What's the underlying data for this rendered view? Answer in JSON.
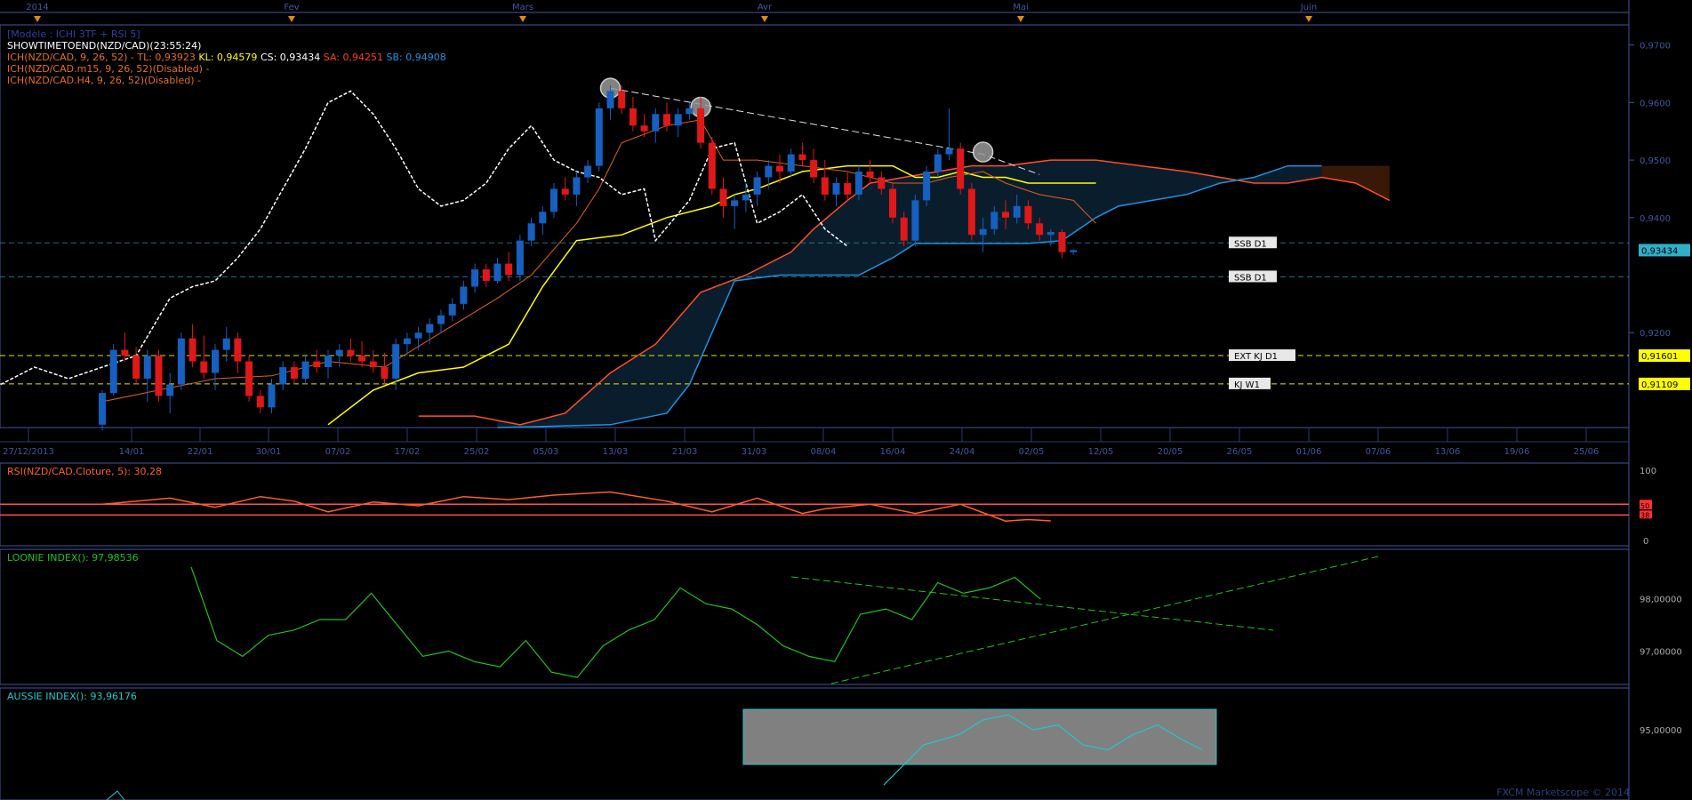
{
  "header": {
    "model": "[Modèle : ICHI 3TF + RSI 5]",
    "show_time": "SHOWTIMETOEND(NZD/CAD)(23:55:24)",
    "ich_main_prefix": "ICH(NZD/CAD, 9, 26, 52) -",
    "tl": "TL: 0,93923",
    "kl": "KL: 0,94579",
    "cs": "CS: 0,93434",
    "sa": "SA: 0,94251",
    "sb": "SB: 0,94908",
    "ich_m15": "ICH(NZD/CAD.m15, 9, 26, 52)(Disabled) -",
    "ich_h4": "ICH(NZD/CAD.H4, 9, 26, 52)(Disabled) -"
  },
  "colors": {
    "blue_candle": "#1560c0",
    "red_candle": "#e01818",
    "tenkan": "#e06020",
    "kijun": "#ffff00",
    "chikou": "#ffffff",
    "ssa": "#ff5020",
    "ssb": "#2090e0",
    "cloud": "#0a1d2c",
    "cloud_bear": "#3a1808",
    "rsi": "#ff6020",
    "loonie": "#20c020",
    "aussie": "#20c8d0",
    "axis": "#4455a0"
  },
  "month_labels": [
    "2014",
    "Fev",
    "Mars",
    "Avr",
    "Mai",
    "Juin"
  ],
  "date_labels": [
    "27/12/2013",
    "14/01",
    "22/01",
    "30/01",
    "07/02",
    "17/02",
    "25/02",
    "05/03",
    "13/03",
    "21/03",
    "31/03",
    "08/04",
    "16/04",
    "24/04",
    "02/05",
    "12/05",
    "20/05",
    "26/05",
    "01/06",
    "07/06",
    "13/06",
    "19/06",
    "25/06"
  ],
  "price_axis": {
    "ticks": [
      "0,9700",
      "0,9600",
      "0,9500",
      "0,9400",
      "0,9200"
    ],
    "current_price": "0,93434"
  },
  "level_lines": [
    {
      "label": "SSB D1",
      "value": 0.9356
    },
    {
      "label": "SSB D1",
      "value": 0.9297
    },
    {
      "label": "EXT KJ D1",
      "value": 0.91601,
      "value_label": "0,91601"
    },
    {
      "label": "KJ W1",
      "value": 0.91109,
      "value_label": "0,91109"
    }
  ],
  "trendline_text": "",
  "rsi_panel": {
    "title": "RSI(NZD/CAD.Cloture, 5): 30,28",
    "axis": [
      "100",
      "0"
    ],
    "levels": [
      "52",
      "50",
      "38"
    ]
  },
  "loonie_panel": {
    "title": "LOONIE INDEX(): 97,98536",
    "axis": [
      "98,00000",
      "97,00000"
    ]
  },
  "aussie_panel": {
    "title": "AUSSIE INDEX(): 93,96176",
    "axis": [
      "95,00000"
    ]
  },
  "watermark": "FXCM Marketscope © 2014",
  "chart_data": {
    "type": "candlestick",
    "title": "",
    "y_range": [
      0.9035,
      0.9735
    ],
    "candles": [
      [
        0.904,
        0.91,
        0.903,
        0.9095
      ],
      [
        0.9095,
        0.918,
        0.909,
        0.917
      ],
      [
        0.917,
        0.92,
        0.915,
        0.916
      ],
      [
        0.916,
        0.9175,
        0.911,
        0.912
      ],
      [
        0.912,
        0.917,
        0.908,
        0.916
      ],
      [
        0.916,
        0.917,
        0.908,
        0.909
      ],
      [
        0.909,
        0.913,
        0.906,
        0.911
      ],
      [
        0.911,
        0.92,
        0.91,
        0.919
      ],
      [
        0.919,
        0.9215,
        0.914,
        0.915
      ],
      [
        0.915,
        0.9195,
        0.912,
        0.913
      ],
      [
        0.913,
        0.918,
        0.91,
        0.917
      ],
      [
        0.917,
        0.921,
        0.915,
        0.919
      ],
      [
        0.919,
        0.92,
        0.913,
        0.915
      ],
      [
        0.915,
        0.916,
        0.908,
        0.909
      ],
      [
        0.909,
        0.91,
        0.906,
        0.907
      ],
      [
        0.907,
        0.912,
        0.906,
        0.911
      ],
      [
        0.911,
        0.915,
        0.91,
        0.914
      ],
      [
        0.914,
        0.915,
        0.911,
        0.912
      ],
      [
        0.912,
        0.916,
        0.911,
        0.915
      ],
      [
        0.915,
        0.917,
        0.913,
        0.914
      ],
      [
        0.914,
        0.917,
        0.912,
        0.916
      ],
      [
        0.916,
        0.918,
        0.914,
        0.917
      ],
      [
        0.917,
        0.919,
        0.915,
        0.916
      ],
      [
        0.916,
        0.9185,
        0.914,
        0.915
      ],
      [
        0.915,
        0.917,
        0.913,
        0.914
      ],
      [
        0.914,
        0.9165,
        0.911,
        0.912
      ],
      [
        0.912,
        0.919,
        0.91,
        0.918
      ],
      [
        0.918,
        0.92,
        0.916,
        0.919
      ],
      [
        0.919,
        0.921,
        0.917,
        0.92
      ],
      [
        0.92,
        0.9225,
        0.918,
        0.9215
      ],
      [
        0.9215,
        0.924,
        0.92,
        0.923
      ],
      [
        0.923,
        0.926,
        0.922,
        0.925
      ],
      [
        0.925,
        0.929,
        0.924,
        0.928
      ],
      [
        0.928,
        0.932,
        0.927,
        0.931
      ],
      [
        0.931,
        0.932,
        0.928,
        0.929
      ],
      [
        0.929,
        0.933,
        0.9285,
        0.932
      ],
      [
        0.932,
        0.934,
        0.929,
        0.93
      ],
      [
        0.93,
        0.937,
        0.929,
        0.936
      ],
      [
        0.936,
        0.94,
        0.935,
        0.939
      ],
      [
        0.939,
        0.942,
        0.937,
        0.941
      ],
      [
        0.941,
        0.946,
        0.94,
        0.945
      ],
      [
        0.945,
        0.947,
        0.943,
        0.944
      ],
      [
        0.944,
        0.948,
        0.942,
        0.947
      ],
      [
        0.947,
        0.95,
        0.946,
        0.949
      ],
      [
        0.949,
        0.96,
        0.948,
        0.959
      ],
      [
        0.959,
        0.963,
        0.957,
        0.962
      ],
      [
        0.962,
        0.963,
        0.958,
        0.959
      ],
      [
        0.959,
        0.961,
        0.955,
        0.956
      ],
      [
        0.956,
        0.958,
        0.954,
        0.955
      ],
      [
        0.955,
        0.959,
        0.953,
        0.958
      ],
      [
        0.958,
        0.96,
        0.955,
        0.956
      ],
      [
        0.956,
        0.959,
        0.954,
        0.958
      ],
      [
        0.958,
        0.96,
        0.957,
        0.959
      ],
      [
        0.959,
        0.961,
        0.952,
        0.953
      ],
      [
        0.953,
        0.954,
        0.944,
        0.945
      ],
      [
        0.945,
        0.947,
        0.94,
        0.942
      ],
      [
        0.942,
        0.944,
        0.938,
        0.943
      ],
      [
        0.943,
        0.946,
        0.941,
        0.944
      ],
      [
        0.944,
        0.948,
        0.942,
        0.947
      ],
      [
        0.947,
        0.95,
        0.945,
        0.949
      ],
      [
        0.949,
        0.951,
        0.946,
        0.948
      ],
      [
        0.948,
        0.952,
        0.947,
        0.951
      ],
      [
        0.951,
        0.953,
        0.949,
        0.95
      ],
      [
        0.95,
        0.952,
        0.946,
        0.947
      ],
      [
        0.947,
        0.95,
        0.943,
        0.944
      ],
      [
        0.944,
        0.947,
        0.942,
        0.946
      ],
      [
        0.946,
        0.948,
        0.943,
        0.944
      ],
      [
        0.944,
        0.949,
        0.943,
        0.948
      ],
      [
        0.948,
        0.95,
        0.946,
        0.947
      ],
      [
        0.947,
        0.948,
        0.944,
        0.945
      ],
      [
        0.945,
        0.946,
        0.939,
        0.94
      ],
      [
        0.94,
        0.941,
        0.935,
        0.936
      ],
      [
        0.936,
        0.944,
        0.935,
        0.943
      ],
      [
        0.943,
        0.949,
        0.942,
        0.948
      ],
      [
        0.948,
        0.952,
        0.947,
        0.951
      ],
      [
        0.951,
        0.959,
        0.95,
        0.952
      ],
      [
        0.952,
        0.953,
        0.944,
        0.945
      ],
      [
        0.945,
        0.946,
        0.936,
        0.937
      ],
      [
        0.937,
        0.94,
        0.934,
        0.938
      ],
      [
        0.938,
        0.942,
        0.937,
        0.941
      ],
      [
        0.941,
        0.943,
        0.938,
        0.94
      ],
      [
        0.94,
        0.944,
        0.939,
        0.942
      ],
      [
        0.942,
        0.943,
        0.938,
        0.939
      ],
      [
        0.939,
        0.94,
        0.936,
        0.937
      ],
      [
        0.937,
        0.938,
        0.935,
        0.9375
      ],
      [
        0.9375,
        0.938,
        0.933,
        0.934
      ],
      [
        0.934,
        0.9345,
        0.9335,
        0.93434
      ]
    ],
    "tenkan": [
      [
        0,
        0.908
      ],
      [
        5,
        0.91
      ],
      [
        10,
        0.912
      ],
      [
        15,
        0.9125
      ],
      [
        20,
        0.915
      ],
      [
        25,
        0.914
      ],
      [
        30,
        0.92
      ],
      [
        35,
        0.926
      ],
      [
        38,
        0.93
      ],
      [
        42,
        0.939
      ],
      [
        44,
        0.945
      ],
      [
        46,
        0.953
      ],
      [
        50,
        0.956
      ],
      [
        53,
        0.957
      ],
      [
        55,
        0.95
      ],
      [
        58,
        0.95
      ],
      [
        62,
        0.949
      ],
      [
        66,
        0.948
      ],
      [
        70,
        0.946
      ],
      [
        73,
        0.946
      ],
      [
        75,
        0.947
      ],
      [
        78,
        0.948
      ],
      [
        80,
        0.946
      ],
      [
        83,
        0.944
      ],
      [
        86,
        0.943
      ],
      [
        88,
        0.939
      ]
    ],
    "kijun": [
      [
        20,
        0.904
      ],
      [
        24,
        0.91
      ],
      [
        28,
        0.913
      ],
      [
        32,
        0.914
      ],
      [
        36,
        0.918
      ],
      [
        39,
        0.928
      ],
      [
        42,
        0.936
      ],
      [
        46,
        0.937
      ],
      [
        50,
        0.94
      ],
      [
        54,
        0.942
      ],
      [
        56,
        0.944
      ],
      [
        58,
        0.945
      ],
      [
        62,
        0.948
      ],
      [
        66,
        0.949
      ],
      [
        70,
        0.949
      ],
      [
        72,
        0.947
      ],
      [
        74,
        0.947
      ],
      [
        76,
        0.948
      ],
      [
        78,
        0.947
      ],
      [
        80,
        0.947
      ],
      [
        82,
        0.946
      ],
      [
        88,
        0.946
      ]
    ],
    "chikou": [
      [
        -9,
        0.911
      ],
      [
        -6,
        0.914
      ],
      [
        -3,
        0.912
      ],
      [
        0,
        0.914
      ],
      [
        3,
        0.916
      ],
      [
        6,
        0.926
      ],
      [
        8,
        0.928
      ],
      [
        10,
        0.929
      ],
      [
        12,
        0.933
      ],
      [
        14,
        0.938
      ],
      [
        16,
        0.945
      ],
      [
        18,
        0.952
      ],
      [
        20,
        0.96
      ],
      [
        22,
        0.962
      ],
      [
        24,
        0.958
      ],
      [
        26,
        0.952
      ],
      [
        28,
        0.945
      ],
      [
        30,
        0.942
      ],
      [
        32,
        0.943
      ],
      [
        34,
        0.946
      ],
      [
        36,
        0.952
      ],
      [
        38,
        0.956
      ],
      [
        40,
        0.95
      ],
      [
        42,
        0.948
      ],
      [
        44,
        0.947
      ],
      [
        46,
        0.944
      ],
      [
        48,
        0.945
      ],
      [
        49,
        0.936
      ],
      [
        52,
        0.943
      ],
      [
        54,
        0.952
      ],
      [
        56,
        0.953
      ],
      [
        58,
        0.939
      ],
      [
        60,
        0.941
      ],
      [
        62,
        0.944
      ],
      [
        64,
        0.938
      ],
      [
        66,
        0.935
      ]
    ],
    "ssa": [
      [
        28,
        0.9055
      ],
      [
        33,
        0.9055
      ],
      [
        37,
        0.904
      ],
      [
        41,
        0.906
      ],
      [
        45,
        0.913
      ],
      [
        49,
        0.918
      ],
      [
        53,
        0.927
      ],
      [
        57,
        0.93
      ],
      [
        61,
        0.934
      ],
      [
        63,
        0.938
      ],
      [
        66,
        0.943
      ],
      [
        68,
        0.946
      ],
      [
        71,
        0.947
      ],
      [
        74,
        0.948
      ],
      [
        77,
        0.949
      ],
      [
        80,
        0.949
      ],
      [
        84,
        0.95
      ],
      [
        88,
        0.95
      ],
      [
        92,
        0.949
      ],
      [
        96,
        0.948
      ],
      [
        99,
        0.947
      ],
      [
        102,
        0.946
      ],
      [
        105,
        0.946
      ],
      [
        108,
        0.947
      ],
      [
        111,
        0.946
      ],
      [
        114,
        0.943
      ]
    ],
    "ssb": [
      [
        35,
        0.9035
      ],
      [
        45,
        0.904
      ],
      [
        50,
        0.906
      ],
      [
        52,
        0.911
      ],
      [
        54,
        0.92
      ],
      [
        56,
        0.929
      ],
      [
        60,
        0.93
      ],
      [
        67,
        0.93
      ],
      [
        70,
        0.933
      ],
      [
        72,
        0.9355
      ],
      [
        78,
        0.9355
      ],
      [
        82,
        0.9355
      ],
      [
        85,
        0.936
      ],
      [
        88,
        0.94
      ],
      [
        90,
        0.942
      ],
      [
        93,
        0.943
      ],
      [
        96,
        0.944
      ],
      [
        99,
        0.946
      ],
      [
        102,
        0.947
      ],
      [
        105,
        0.949
      ],
      [
        108,
        0.949
      ]
    ],
    "trendline": [
      [
        45,
        0.9625
      ],
      [
        78,
        0.951
      ],
      [
        83,
        0.9475
      ]
    ],
    "rsi": [
      [
        0,
        52
      ],
      [
        6,
        60
      ],
      [
        10,
        48
      ],
      [
        14,
        62
      ],
      [
        17,
        56
      ],
      [
        20,
        42
      ],
      [
        24,
        55
      ],
      [
        28,
        50
      ],
      [
        32,
        62
      ],
      [
        36,
        58
      ],
      [
        40,
        64
      ],
      [
        45,
        68
      ],
      [
        50,
        56
      ],
      [
        54,
        42
      ],
      [
        58,
        60
      ],
      [
        62,
        40
      ],
      [
        64,
        46
      ],
      [
        68,
        52
      ],
      [
        72,
        40
      ],
      [
        76,
        52
      ],
      [
        80,
        30
      ],
      [
        82,
        32
      ],
      [
        84,
        30.28
      ]
    ],
    "loonie": [
      [
        0,
        98.6
      ],
      [
        3,
        97.2
      ],
      [
        6,
        96.9
      ],
      [
        9,
        97.3
      ],
      [
        12,
        97.4
      ],
      [
        15,
        97.6
      ],
      [
        18,
        97.6
      ],
      [
        21,
        98.1
      ],
      [
        24,
        97.5
      ],
      [
        27,
        96.9
      ],
      [
        30,
        97.0
      ],
      [
        33,
        96.8
      ],
      [
        36,
        96.7
      ],
      [
        39,
        97.2
      ],
      [
        42,
        96.6
      ],
      [
        45,
        96.5
      ],
      [
        48,
        97.1
      ],
      [
        51,
        97.4
      ],
      [
        54,
        97.6
      ],
      [
        57,
        98.2
      ],
      [
        60,
        97.9
      ],
      [
        63,
        97.8
      ],
      [
        66,
        97.5
      ],
      [
        69,
        97.1
      ],
      [
        72,
        96.9
      ],
      [
        75,
        96.8
      ],
      [
        78,
        97.7
      ],
      [
        81,
        97.8
      ],
      [
        84,
        97.6
      ],
      [
        87,
        98.3
      ],
      [
        90,
        98.1
      ],
      [
        93,
        98.2
      ],
      [
        96,
        98.4
      ],
      [
        99,
        97.98536
      ]
    ],
    "aussie": [
      [
        40,
        93.9
      ],
      [
        48,
        94.7
      ],
      [
        55,
        94.9
      ],
      [
        60,
        95.2
      ],
      [
        65,
        95.3
      ],
      [
        70,
        95.0
      ],
      [
        75,
        95.1
      ],
      [
        80,
        94.7
      ],
      [
        85,
        94.6
      ],
      [
        90,
        94.9
      ],
      [
        95,
        95.1
      ],
      [
        100,
        94.8
      ],
      [
        104,
        94.6
      ]
    ]
  }
}
